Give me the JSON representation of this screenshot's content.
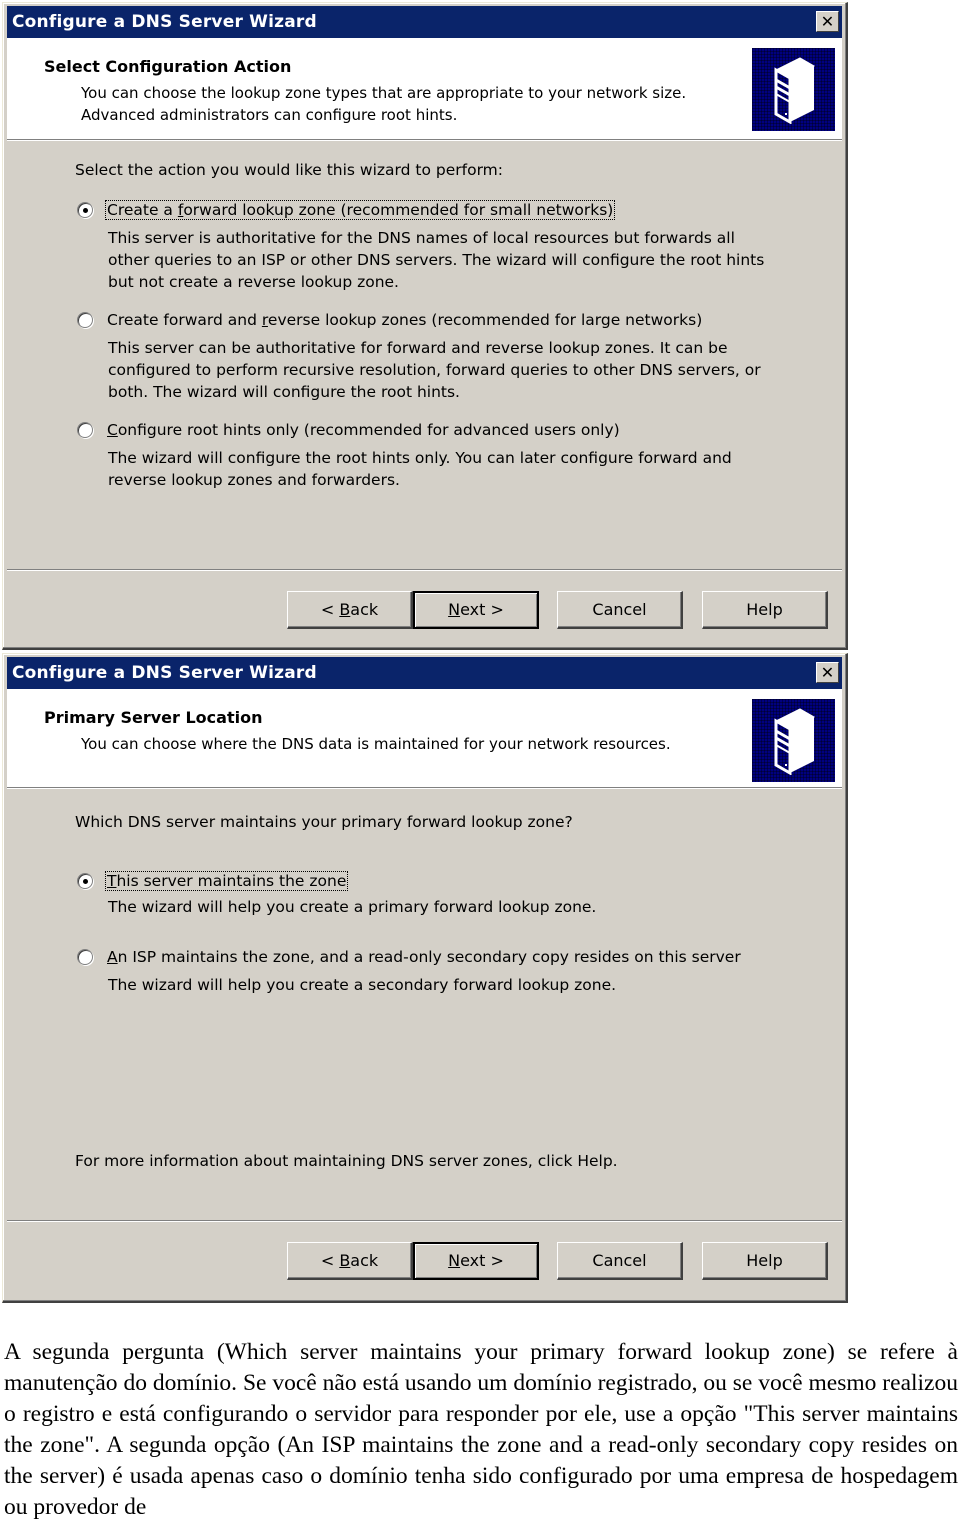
{
  "wizard1": {
    "title": "Configure a DNS Server Wizard",
    "close_label": "✕",
    "header_title": "Select Configuration Action",
    "header_desc": "You can choose the lookup zone types that are appropriate to your network size. Advanced administrators can configure root hints.",
    "header_icon": "server-icon",
    "prompt": "Select the action you would like this wizard to perform:",
    "options": [
      {
        "label_pre": "Create a ",
        "label_mnemonic": "f",
        "label_post": "orward lookup zone (recommended for small networks)",
        "desc": "This server is authoritative for the DNS names of local resources but forwards all other queries to an ISP or other DNS servers. The wizard will configure the root hints but not create a reverse lookup zone.",
        "checked": true
      },
      {
        "label_pre": "Create forward and ",
        "label_mnemonic": "r",
        "label_post": "everse lookup zones (recommended for large networks)",
        "desc": "This server can be authoritative for forward and reverse lookup zones. It can be configured to perform recursive resolution, forward queries to other DNS servers, or both. The wizard will configure the root hints.",
        "checked": false
      },
      {
        "label_pre": "",
        "label_mnemonic": "C",
        "label_post": "onfigure root hints only (recommended for advanced users only)",
        "desc": "The wizard will configure the root hints only. You can later configure forward and reverse lookup zones and forwarders.",
        "checked": false
      }
    ],
    "buttons": {
      "back": {
        "pre": "< ",
        "mnemonic": "B",
        "post": "ack"
      },
      "next": {
        "pre": "",
        "mnemonic": "N",
        "post": "ext >"
      },
      "cancel": "Cancel",
      "help": "Help"
    }
  },
  "wizard2": {
    "title": "Configure a DNS Server Wizard",
    "close_label": "✕",
    "header_title": "Primary Server Location",
    "header_desc": "You can choose where the DNS data is maintained for your network resources.",
    "header_icon": "server-icon",
    "prompt": "Which DNS server maintains your primary forward lookup zone?",
    "options": [
      {
        "label_pre": "",
        "label_mnemonic": "T",
        "label_post": "his server maintains the zone",
        "desc": "The wizard will help you create a primary forward lookup zone.",
        "checked": true
      },
      {
        "label_pre": "",
        "label_mnemonic": "A",
        "label_post": "n ISP maintains the zone, and a read-only secondary copy resides on this server",
        "desc": "The wizard will help you create a secondary forward lookup zone.",
        "checked": false
      }
    ],
    "footer_note": "For more information about maintaining DNS server zones, click Help.",
    "buttons": {
      "back": {
        "pre": "< ",
        "mnemonic": "B",
        "post": "ack"
      },
      "next": {
        "pre": "",
        "mnemonic": "N",
        "post": "ext >"
      },
      "cancel": "Cancel",
      "help": "Help"
    }
  },
  "article": {
    "paragraph": "A segunda pergunta (Which server maintains your primary forward lookup zone) se refere à manutenção do domínio. Se você não está usando um domínio registrado, ou se você mesmo realizou o registro e está configurando o servidor para responder por ele, use a opção \"This server maintains the zone\". A segunda opção (An ISP maintains the zone and a read-only secondary copy resides on the server) é usada apenas caso o domínio tenha sido configurado por uma empresa de hospedagem ou provedor de"
  },
  "colors": {
    "titlebar": "#0a246a",
    "dialog_face": "#d4d0c8",
    "header_bg": "#ffffff",
    "icon_bg": "#000080"
  }
}
